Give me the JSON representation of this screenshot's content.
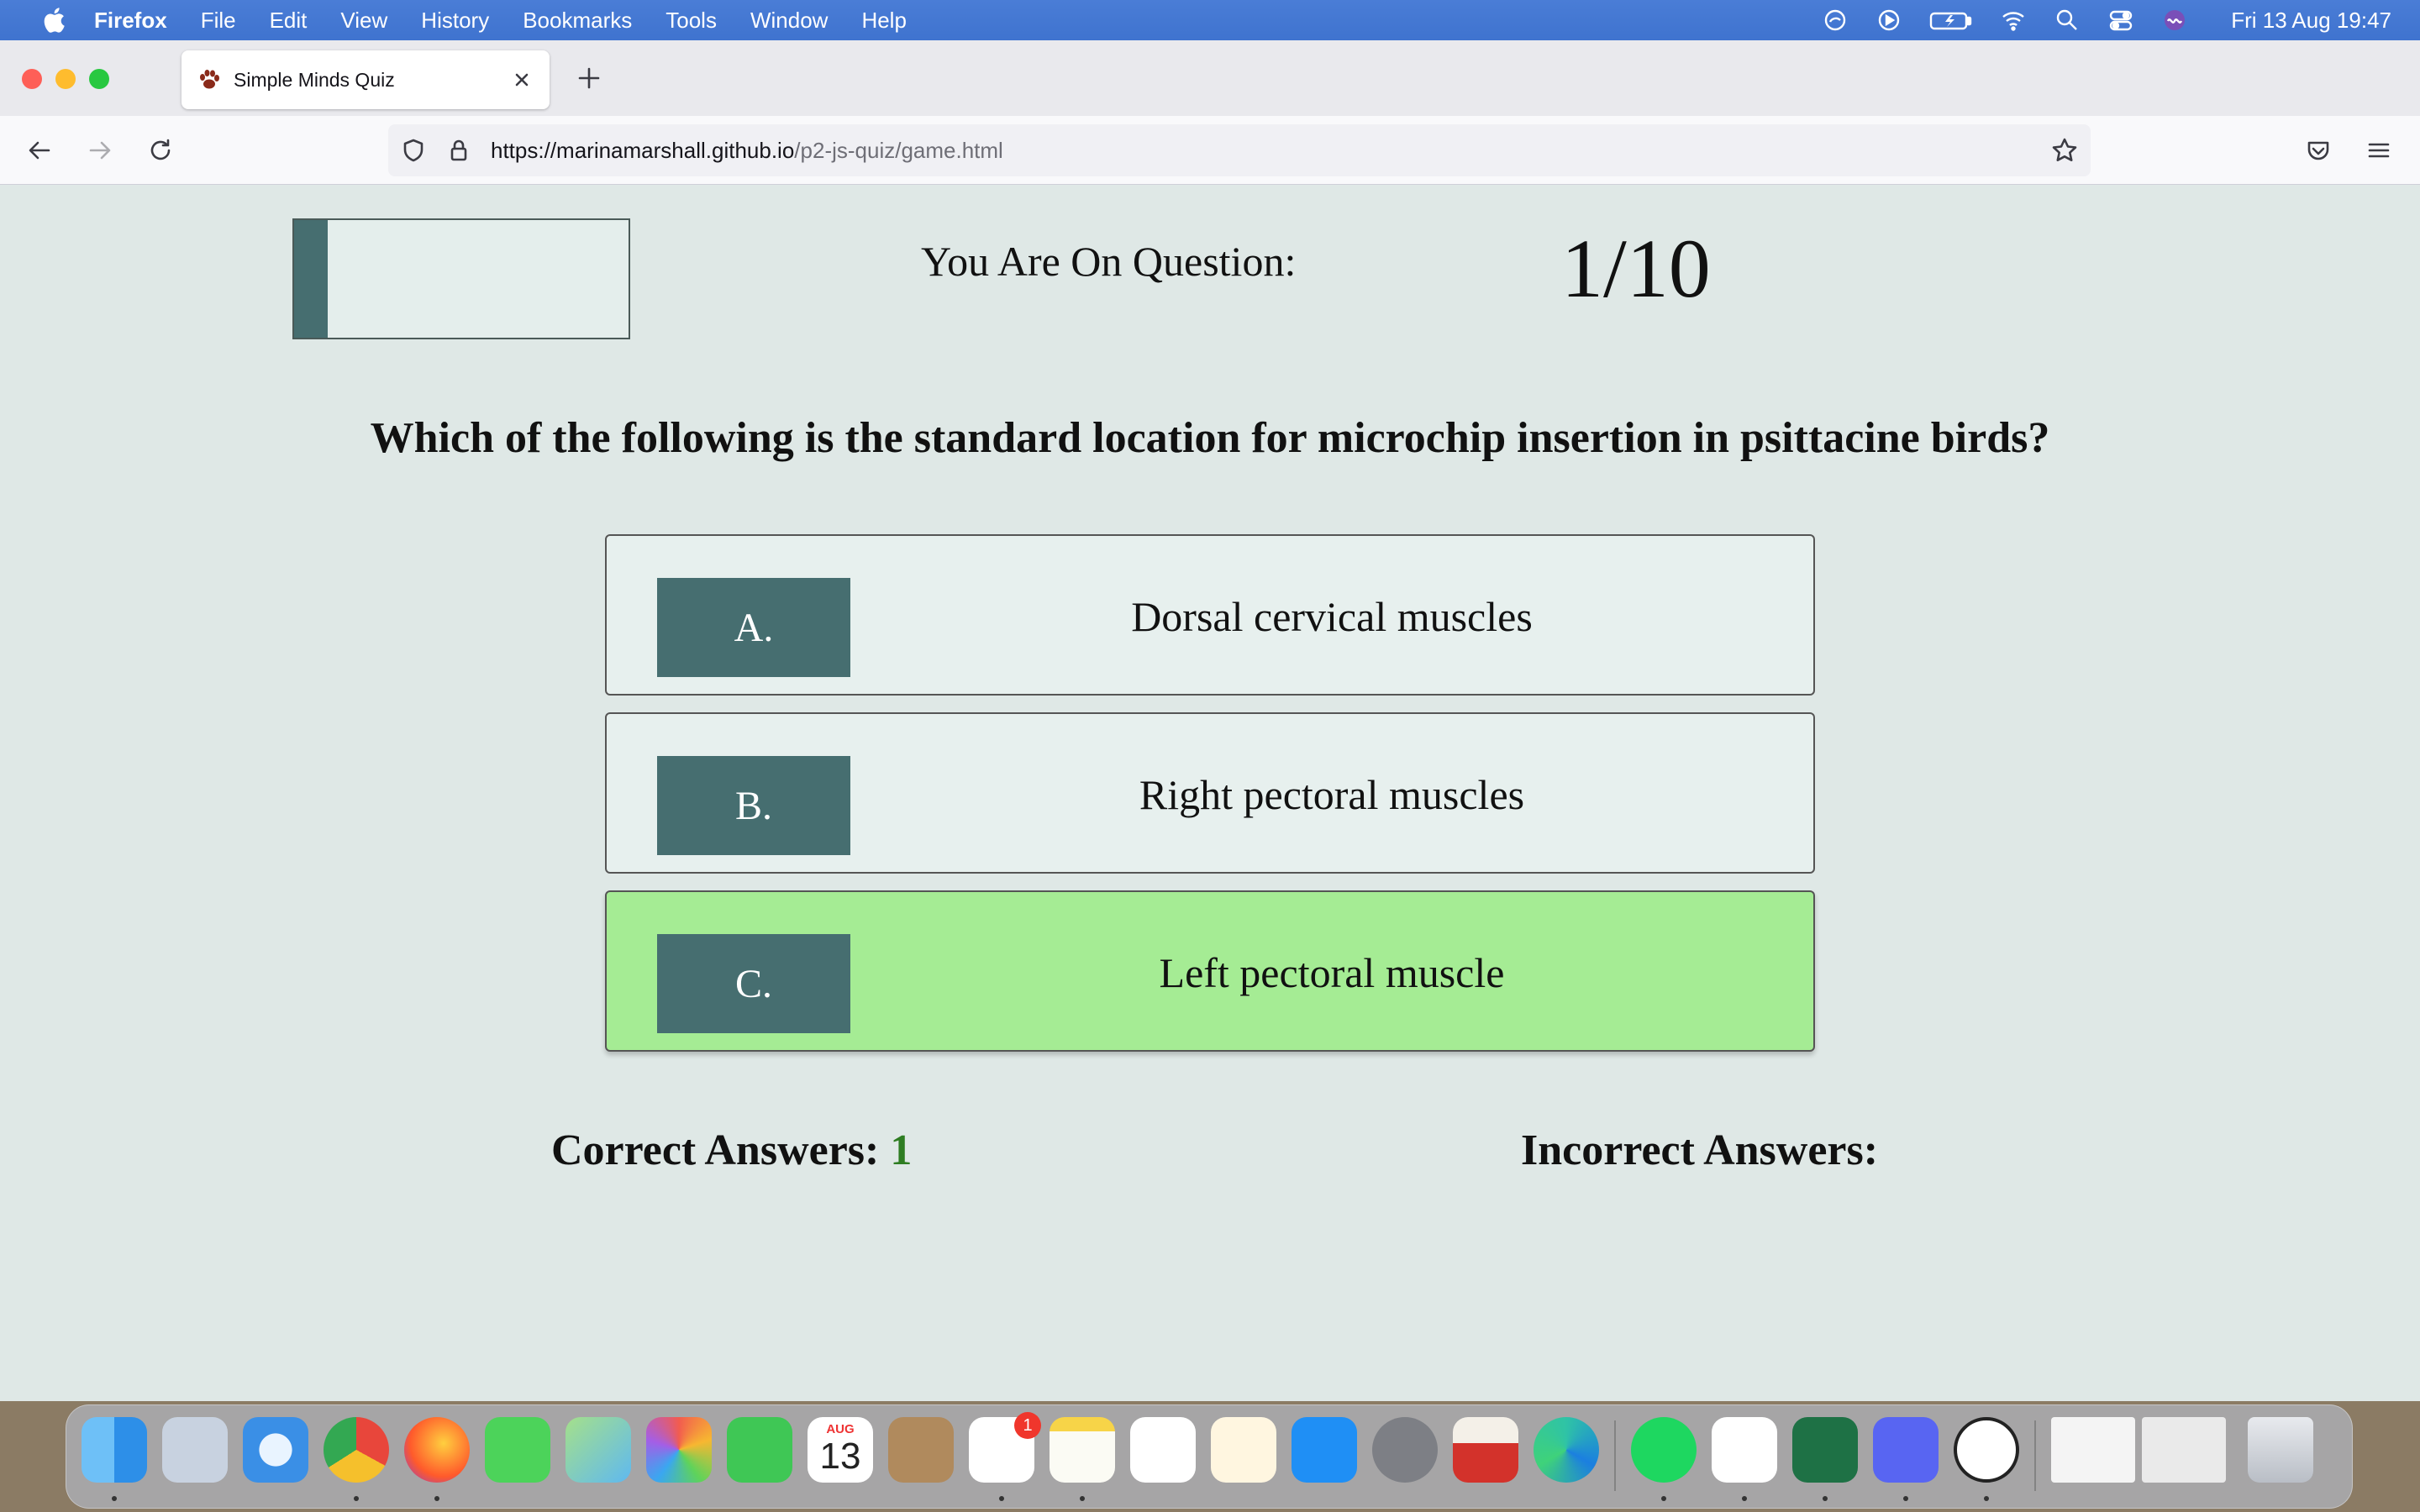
{
  "menubar": {
    "app_name": "Firefox",
    "items": [
      "File",
      "Edit",
      "View",
      "History",
      "Bookmarks",
      "Tools",
      "Window",
      "Help"
    ],
    "clock": "Fri 13 Aug  19:47",
    "status_icons": [
      "creative-cloud-icon",
      "play-circle-icon",
      "battery-icon",
      "wifi-icon",
      "spotlight-search-icon",
      "control-center-icon",
      "siri-icon"
    ]
  },
  "browser": {
    "tab_title": "Simple Minds Quiz",
    "url_domain": "https://marinamarshall.github.io",
    "url_path": "/p2-js-quiz/game.html"
  },
  "quiz": {
    "progress_fraction": 0.1,
    "question_label": "You Are On Question:",
    "question_counter": "1/10",
    "question": "Which of the following is the standard location for microchip insertion in psittacine birds?",
    "options": [
      {
        "letter": "A.",
        "text": "Dorsal cervical muscles"
      },
      {
        "letter": "B.",
        "text": "Right pectoral muscles"
      },
      {
        "letter": "C.",
        "text": "Left pectoral muscle"
      }
    ],
    "selected_option": "C.",
    "correct_label": "Correct Answers:",
    "correct_count": "1",
    "incorrect_label": "Incorrect Answers:",
    "incorrect_count": ""
  },
  "dock": {
    "apps": [
      "Finder",
      "Launchpad",
      "Safari",
      "Chrome",
      "Firefox",
      "Messages",
      "Maps",
      "Photos",
      "FaceTime",
      "Calendar",
      "Contacts",
      "Reminders",
      "Notes",
      "Numbers",
      "Pages",
      "App Store",
      "System Preferences",
      "Popcorn Time",
      "Edge",
      "Spotify",
      "Slack",
      "Excel",
      "Discord",
      "Smile",
      "Documents",
      "Trash"
    ],
    "calendar_month": "AUG",
    "calendar_day": "13",
    "reminders_badge": "1",
    "colors": {
      "accent": "#466e70",
      "selected": "#a5ec94",
      "page_bg": "#dfe8e6",
      "correct_text": "#2e7d22"
    }
  }
}
